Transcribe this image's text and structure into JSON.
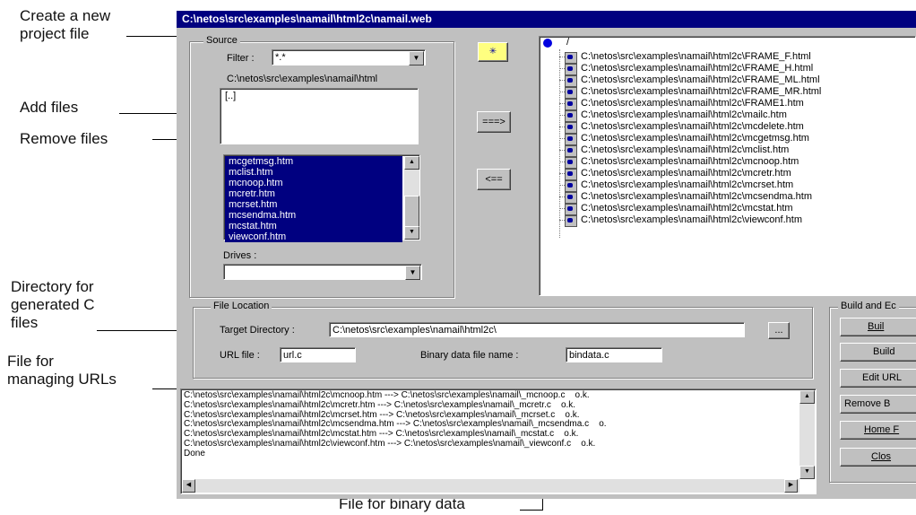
{
  "window": {
    "title": "C:\\netos\\src\\examples\\namail\\html2c\\namail.web"
  },
  "callouts": {
    "create_project": "Create a new\nproject file",
    "add_files": "Add files",
    "remove_files": "Remove files",
    "directory_generated": "Directory for\ngenerated C\nfiles",
    "file_urls": "File for\nmanaging URLs",
    "binary_data": "File for binary data"
  },
  "source": {
    "group_label": "Source",
    "filter_label": "Filter :",
    "filter_value": "*.*",
    "current_path": "C:\\netos\\src\\examples\\namail\\html",
    "dir_list": [
      "[..]"
    ],
    "file_list": [
      "mcgetmsg.htm",
      "mclist.htm",
      "mcnoop.htm",
      "mcretr.htm",
      "mcrset.htm",
      "mcsendma.htm",
      "mcstat.htm",
      "viewconf.htm"
    ],
    "drives_label": "Drives :",
    "drives_value": ""
  },
  "buttons": {
    "add": "===>",
    "remove": "<==",
    "browse": "..."
  },
  "tree": {
    "header": "/",
    "files": [
      "C:\\netos\\src\\examples\\namail\\html2c\\FRAME_F.html",
      "C:\\netos\\src\\examples\\namail\\html2c\\FRAME_H.html",
      "C:\\netos\\src\\examples\\namail\\html2c\\FRAME_ML.html",
      "C:\\netos\\src\\examples\\namail\\html2c\\FRAME_MR.html",
      "C:\\netos\\src\\examples\\namail\\html2c\\FRAME1.htm",
      "C:\\netos\\src\\examples\\namail\\html2c\\mailc.htm",
      "C:\\netos\\src\\examples\\namail\\html2c\\mcdelete.htm",
      "C:\\netos\\src\\examples\\namail\\html2c\\mcgetmsg.htm",
      "C:\\netos\\src\\examples\\namail\\html2c\\mclist.htm",
      "C:\\netos\\src\\examples\\namail\\html2c\\mcnoop.htm",
      "C:\\netos\\src\\examples\\namail\\html2c\\mcretr.htm",
      "C:\\netos\\src\\examples\\namail\\html2c\\mcrset.htm",
      "C:\\netos\\src\\examples\\namail\\html2c\\mcsendma.htm",
      "C:\\netos\\src\\examples\\namail\\html2c\\mcstat.htm",
      "C:\\netos\\src\\examples\\namail\\html2c\\viewconf.htm"
    ]
  },
  "file_location": {
    "group_label": "File Location",
    "target_dir_label": "Target Directory :",
    "target_dir_value": "C:\\netos\\src\\examples\\namail\\html2c\\",
    "url_label": "URL file :",
    "url_value": "url.c",
    "binary_label": "Binary data file name :",
    "binary_value": "bindata.c"
  },
  "build": {
    "group_label": "Build and Ec",
    "buttons": [
      "Buil",
      "Build",
      "Edit URL",
      "Remove B",
      "Home F",
      "Clos"
    ]
  },
  "log": {
    "lines": [
      "C:\\netos\\src\\examples\\namail\\html2c\\mcnoop.htm ---> C:\\netos\\src\\examples\\namail\\_mcnoop.c    o.k.",
      "C:\\netos\\src\\examples\\namail\\html2c\\mcretr.htm ---> C:\\netos\\src\\examples\\namail\\_mcretr.c    o.k.",
      "C:\\netos\\src\\examples\\namail\\html2c\\mcrset.htm ---> C:\\netos\\src\\examples\\namail\\_mcrset.c    o.k.",
      "C:\\netos\\src\\examples\\namail\\html2c\\mcsendma.htm ---> C:\\netos\\src\\examples\\namail\\_mcsendma.c    o.",
      "C:\\netos\\src\\examples\\namail\\html2c\\mcstat.htm ---> C:\\netos\\src\\examples\\namail\\_mcstat.c    o.k.",
      "C:\\netos\\src\\examples\\namail\\html2c\\viewconf.htm ---> C:\\netos\\src\\examples\\namail\\_viewconf.c    o.k.",
      "Done"
    ]
  }
}
